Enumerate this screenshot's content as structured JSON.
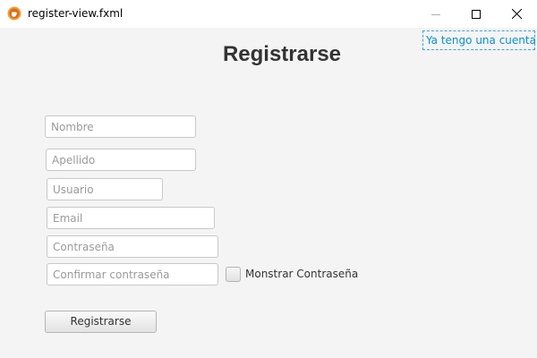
{
  "window": {
    "title": "register-view.fxml",
    "icon": "java-cup-icon",
    "controls": {
      "minimize": "minimize-icon",
      "maximize": "maximize-icon",
      "close": "close-icon"
    }
  },
  "header": {
    "title": "Registrarse",
    "login_link": "Ya tengo una cuenta"
  },
  "form": {
    "nombre": {
      "placeholder": "Nombre",
      "value": ""
    },
    "apellido": {
      "placeholder": "Apellido",
      "value": ""
    },
    "usuario": {
      "placeholder": "Usuario",
      "value": ""
    },
    "email": {
      "placeholder": "Email",
      "value": ""
    },
    "contrasena": {
      "placeholder": "Contraseña",
      "value": ""
    },
    "confirmar": {
      "placeholder": "Confirmar contraseña",
      "value": ""
    },
    "show_password_label": "Monstrar Contraseña",
    "show_password_checked": false,
    "submit_label": "Registrarse"
  },
  "colors": {
    "background": "#f4f4f4",
    "link": "#0a8fcf",
    "link_border": "#3fa4d6",
    "heading": "#333333"
  }
}
